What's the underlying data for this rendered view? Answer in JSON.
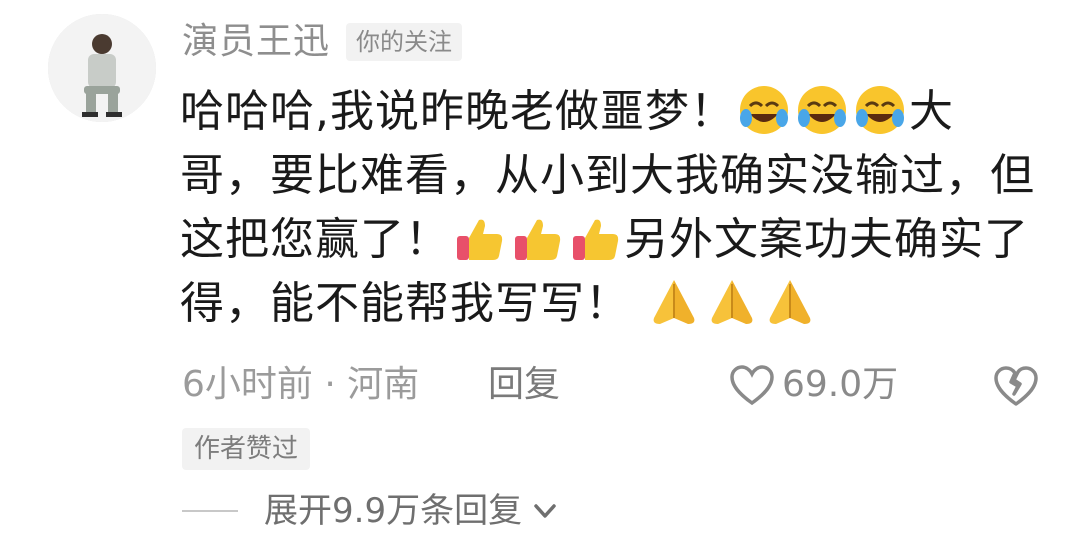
{
  "comment": {
    "username": "演员王迅",
    "follow_badge": "你的关注",
    "text": {
      "part1": "哈哈哈,我说昨晚老做噩梦！",
      "part2": "大哥，要比难看，从小到大我确实没输过，但这把您赢了！",
      "part3": "另外文案功夫确实了得，能不能帮我写写！"
    },
    "emojis": [
      "laughing-crying-emoji",
      "laughing-crying-emoji",
      "laughing-crying-emoji",
      "thumbs-up-emoji",
      "thumbs-up-emoji",
      "thumbs-up-emoji",
      "praying-hands-emoji",
      "praying-hands-emoji",
      "praying-hands-emoji"
    ],
    "time_location": "6小时前 · 河南",
    "reply_label": "回复",
    "like_count": "69.0万",
    "author_liked_badge": "作者赞过",
    "expand_replies": "展开9.9万条回复"
  },
  "colors": {
    "username": "#8e8e8e",
    "text": "#1a1a1a",
    "meta": "#9b9b9b",
    "badge_bg": "#f2f2f2"
  }
}
